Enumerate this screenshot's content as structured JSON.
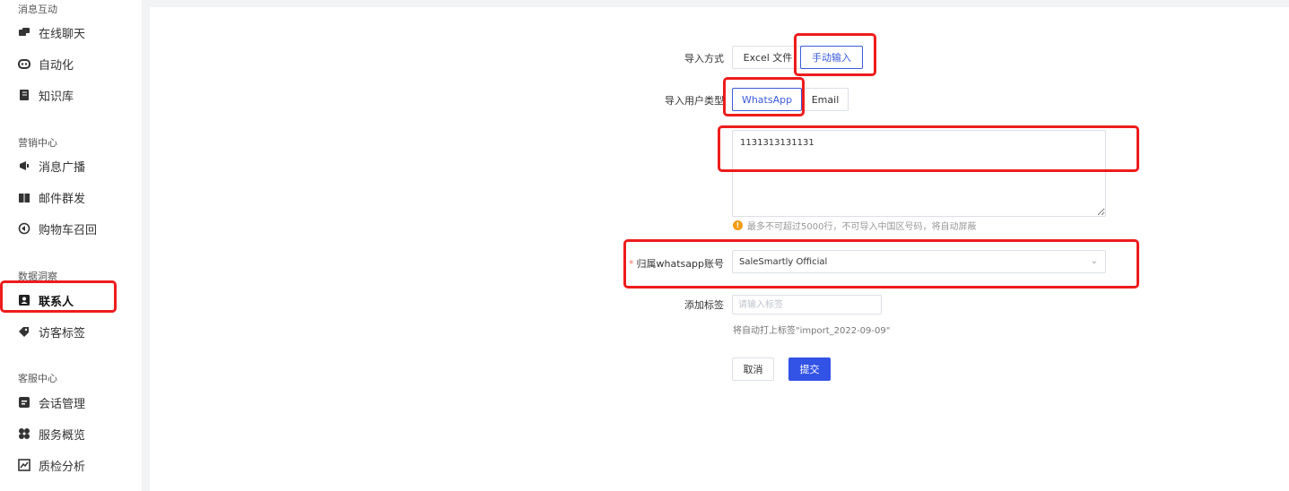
{
  "sidebar": {
    "sections": [
      {
        "title": "消息互动",
        "items": [
          {
            "label": "在线聊天",
            "icon": "chat-icon"
          },
          {
            "label": "自动化",
            "icon": "robot-icon"
          },
          {
            "label": "知识库",
            "icon": "book-icon"
          }
        ]
      },
      {
        "title": "营销中心",
        "items": [
          {
            "label": "消息广播",
            "icon": "broadcast-icon"
          },
          {
            "label": "邮件群发",
            "icon": "gift-icon"
          },
          {
            "label": "购物车召回",
            "icon": "recall-icon"
          }
        ]
      },
      {
        "title": "数据洞察",
        "items": [
          {
            "label": "联系人",
            "icon": "contact-icon"
          },
          {
            "label": "访客标签",
            "icon": "tag-icon"
          }
        ]
      },
      {
        "title": "客服中心",
        "items": [
          {
            "label": "会话管理",
            "icon": "session-icon"
          },
          {
            "label": "服务概览",
            "icon": "overview-icon"
          },
          {
            "label": "质检分析",
            "icon": "analysis-icon"
          }
        ]
      }
    ]
  },
  "form": {
    "import_method": {
      "label": "导入方式",
      "options": [
        "Excel 文件",
        "手动输入"
      ],
      "selected": "手动输入"
    },
    "user_type": {
      "label": "导入用户类型",
      "options": [
        "WhatsApp",
        "Email"
      ],
      "selected": "WhatsApp"
    },
    "numbers_value": "1131313131131",
    "hint": "最多不可超过5000行，不可导入中国区号码，将自动屏蔽",
    "account": {
      "required_mark": "*",
      "label": "归属whatsapp账号",
      "value": "SaleSmartly Official"
    },
    "tags": {
      "label": "添加标签",
      "placeholder": "请输入标签",
      "note": "将自动打上标签\"import_2022-09-09\""
    },
    "cancel_label": "取消",
    "submit_label": "提交"
  },
  "colors": {
    "accent": "#3253e6",
    "annotation": "#ee1c1c",
    "warning": "#f39c12"
  }
}
